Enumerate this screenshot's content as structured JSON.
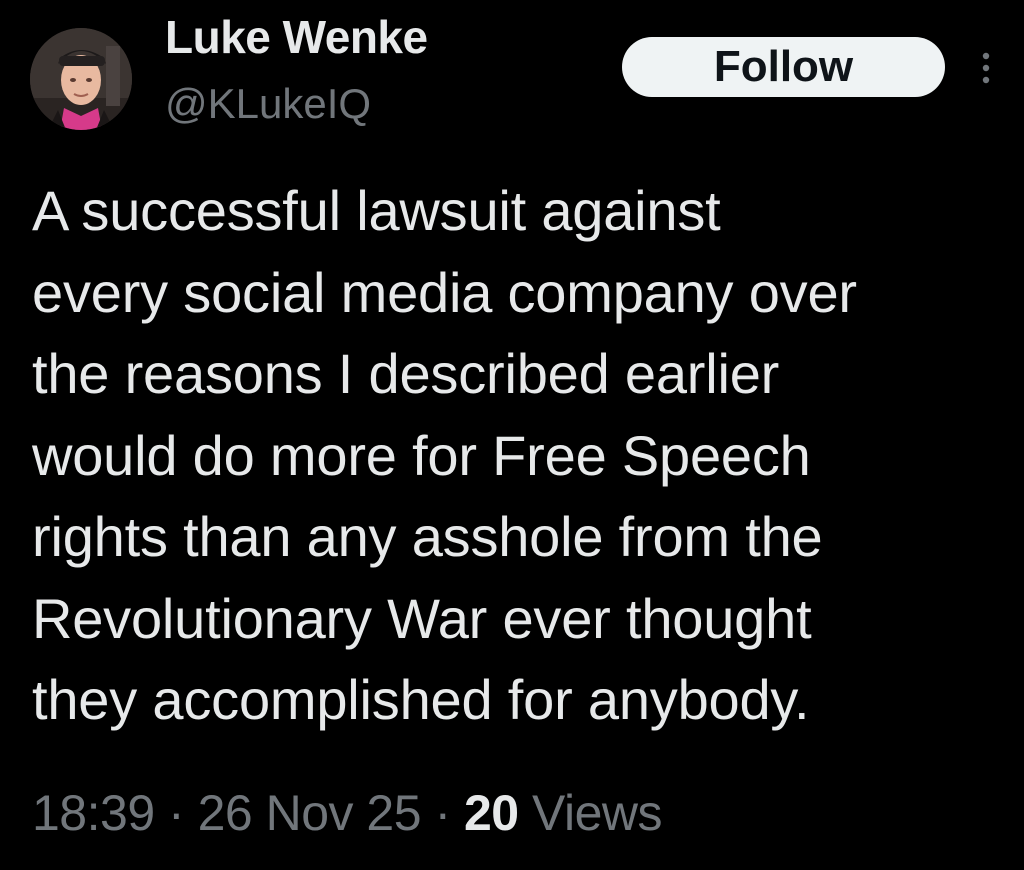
{
  "user": {
    "display_name": "Luke Wenke",
    "handle": "@KLukeIQ",
    "avatar_icon": "user-avatar-photo"
  },
  "actions": {
    "follow_label": "Follow",
    "more_icon": "vertical-ellipsis-icon"
  },
  "tweet": {
    "lines": [
      "A successful lawsuit against",
      "every social media company over",
      "the reasons I described earlier",
      "would do more for Free Speech",
      "rights than any asshole from the",
      "Revolutionary War ever thought",
      "they accomplished for anybody."
    ]
  },
  "meta": {
    "time": "18:39",
    "separator": "·",
    "date": "26 Nov 25",
    "views_count": "20",
    "views_label": "Views"
  },
  "colors": {
    "background": "#000000",
    "primary_text": "#e7e9ea",
    "secondary_text": "#71767b",
    "follow_bg": "#eff3f4"
  }
}
